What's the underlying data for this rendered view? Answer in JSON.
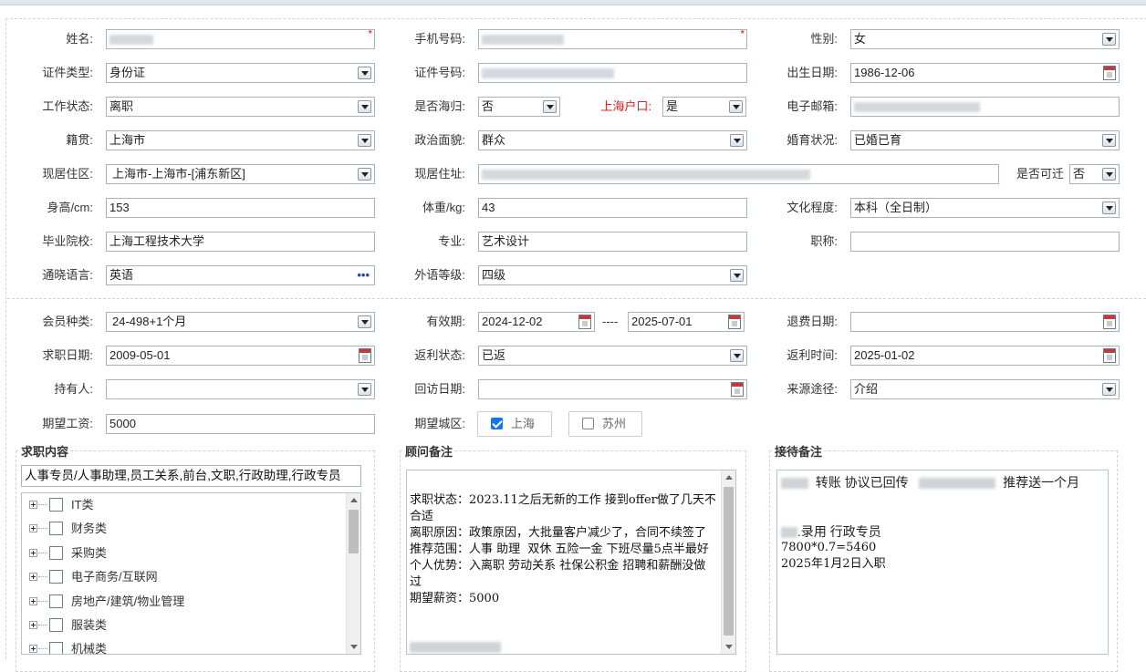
{
  "form": {
    "name": {
      "label": "姓名:"
    },
    "phone": {
      "label": "手机号码:"
    },
    "gender": {
      "label": "性别:",
      "value": "女"
    },
    "id_type": {
      "label": "证件类型:",
      "value": "身份证"
    },
    "id_number": {
      "label": "证件号码:"
    },
    "birth_date": {
      "label": "出生日期:",
      "value": "1986-12-06"
    },
    "work_status": {
      "label": "工作状态:",
      "value": "离职"
    },
    "returnee": {
      "label": "是否海归:",
      "value": "否"
    },
    "sh_hukou": {
      "label": "上海户口:",
      "value": "是"
    },
    "email": {
      "label": "电子邮箱:"
    },
    "native_place": {
      "label": "籍贯:",
      "value": "上海市"
    },
    "political": {
      "label": "政治面貌:",
      "value": "群众"
    },
    "marital": {
      "label": "婚育状况:",
      "value": "已婚已育"
    },
    "residence_area": {
      "label": "现居住区:",
      "value": "上海市-上海市-[浦东新区]"
    },
    "residence_addr": {
      "label": "现居住址:"
    },
    "relocatable": {
      "label": "是否可迁",
      "value": "否"
    },
    "height": {
      "label": "身高/cm:",
      "value": "153"
    },
    "weight": {
      "label": "体重/kg:",
      "value": "43"
    },
    "education": {
      "label": "文化程度:",
      "value": "本科（全日制）"
    },
    "school": {
      "label": "毕业院校:",
      "value": "上海工程技术大学"
    },
    "major": {
      "label": "专业:",
      "value": "艺术设计"
    },
    "title": {
      "label": "职称:",
      "value": ""
    },
    "language": {
      "label": "通晓语言:",
      "value": "英语",
      "more": "•••"
    },
    "lang_level": {
      "label": "外语等级:",
      "value": "四级"
    },
    "member_type": {
      "label": "会员种类:",
      "value": "24-498+1个月"
    },
    "valid_period": {
      "label": "有效期:",
      "from": "2024-12-02",
      "sep": "----",
      "to": "2025-07-01"
    },
    "refund_date": {
      "label": "退费日期:",
      "value": ""
    },
    "job_search_date": {
      "label": "求职日期:",
      "value": "2009-05-01"
    },
    "rebate_status": {
      "label": "返利状态:",
      "value": "已返"
    },
    "rebate_time": {
      "label": "返利时间:",
      "value": "2025-01-02"
    },
    "holder": {
      "label": "持有人:",
      "value": ""
    },
    "revisit_date": {
      "label": "回访日期:",
      "value": ""
    },
    "source": {
      "label": "来源途径:",
      "value": "介绍"
    },
    "expected_salary": {
      "label": "期望工资:",
      "value": "5000"
    },
    "expected_city": {
      "label": "期望城区:",
      "options": [
        {
          "label": "上海",
          "checked": true
        },
        {
          "label": "苏州",
          "checked": false
        }
      ]
    }
  },
  "job_content": {
    "legend": "求职内容",
    "selected": "人事专员/人事助理,员工关系,前台,文职,行政助理,行政专员",
    "tree": [
      "IT类",
      "财务类",
      "采购类",
      "电子商务/互联网",
      "房地产/建筑/物业管理",
      "服装类",
      "机械类"
    ]
  },
  "consultant_notes": {
    "legend": "顾问备注",
    "text": "\n求职状态：2023.11之后无新的工作 接到offer做了几天不合适\n离职原因：政策原因，大批量客户减少了，合同不续签了\n推荐范围：人事 助理  双休 五险一金 下班尽量5点半最好\n个人优势：入离职 劳动关系 社保公积金 招聘和薪酬没做过\n期望薪资：5000"
  },
  "reception_notes": {
    "legend": "接待备注",
    "line1_a": "转账  协议已回传",
    "line1_b": "推荐送一个月",
    "line2": ".录用  行政专员",
    "line3": "7800*0.7=5460",
    "line4": "2025年1月2日入职"
  },
  "colors": {
    "required": "#e02020",
    "hukou_label": "#d42020",
    "checkbox_on": "#1a73e8"
  }
}
